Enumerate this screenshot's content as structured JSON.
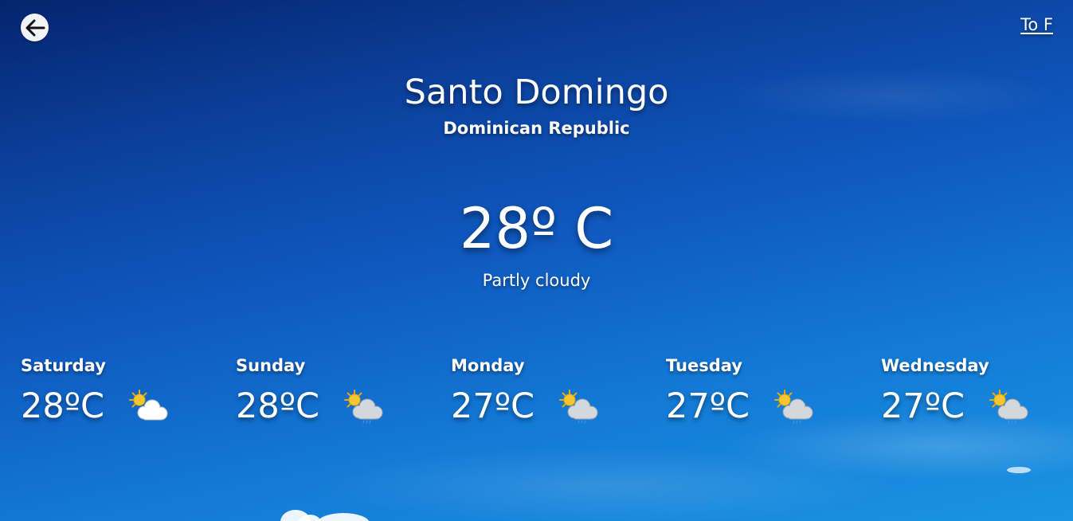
{
  "nav": {
    "back_icon": "arrow-left-icon",
    "unit_toggle_label": "To F"
  },
  "location": {
    "city": "Santo Domingo",
    "country": "Dominican Republic"
  },
  "current": {
    "temperature": "28º C",
    "condition": "Partly cloudy"
  },
  "forecast": [
    {
      "day": "Saturday",
      "temp": "28ºC",
      "icon": "partly-cloudy-icon"
    },
    {
      "day": "Sunday",
      "temp": "28ºC",
      "icon": "sun-cloud-rain-icon"
    },
    {
      "day": "Monday",
      "temp": "27ºC",
      "icon": "sun-cloud-rain-icon"
    },
    {
      "day": "Tuesday",
      "temp": "27ºC",
      "icon": "sun-cloud-rain-icon"
    },
    {
      "day": "Wednesday",
      "temp": "27ºC",
      "icon": "sun-cloud-rain-icon"
    }
  ],
  "colors": {
    "sky_top": "#05246e",
    "sky_bottom": "#1b94e2",
    "text": "#ffffff",
    "sun": "#f7c531",
    "cloud_white": "#ffffff",
    "cloud_grey": "#cfd4da"
  }
}
